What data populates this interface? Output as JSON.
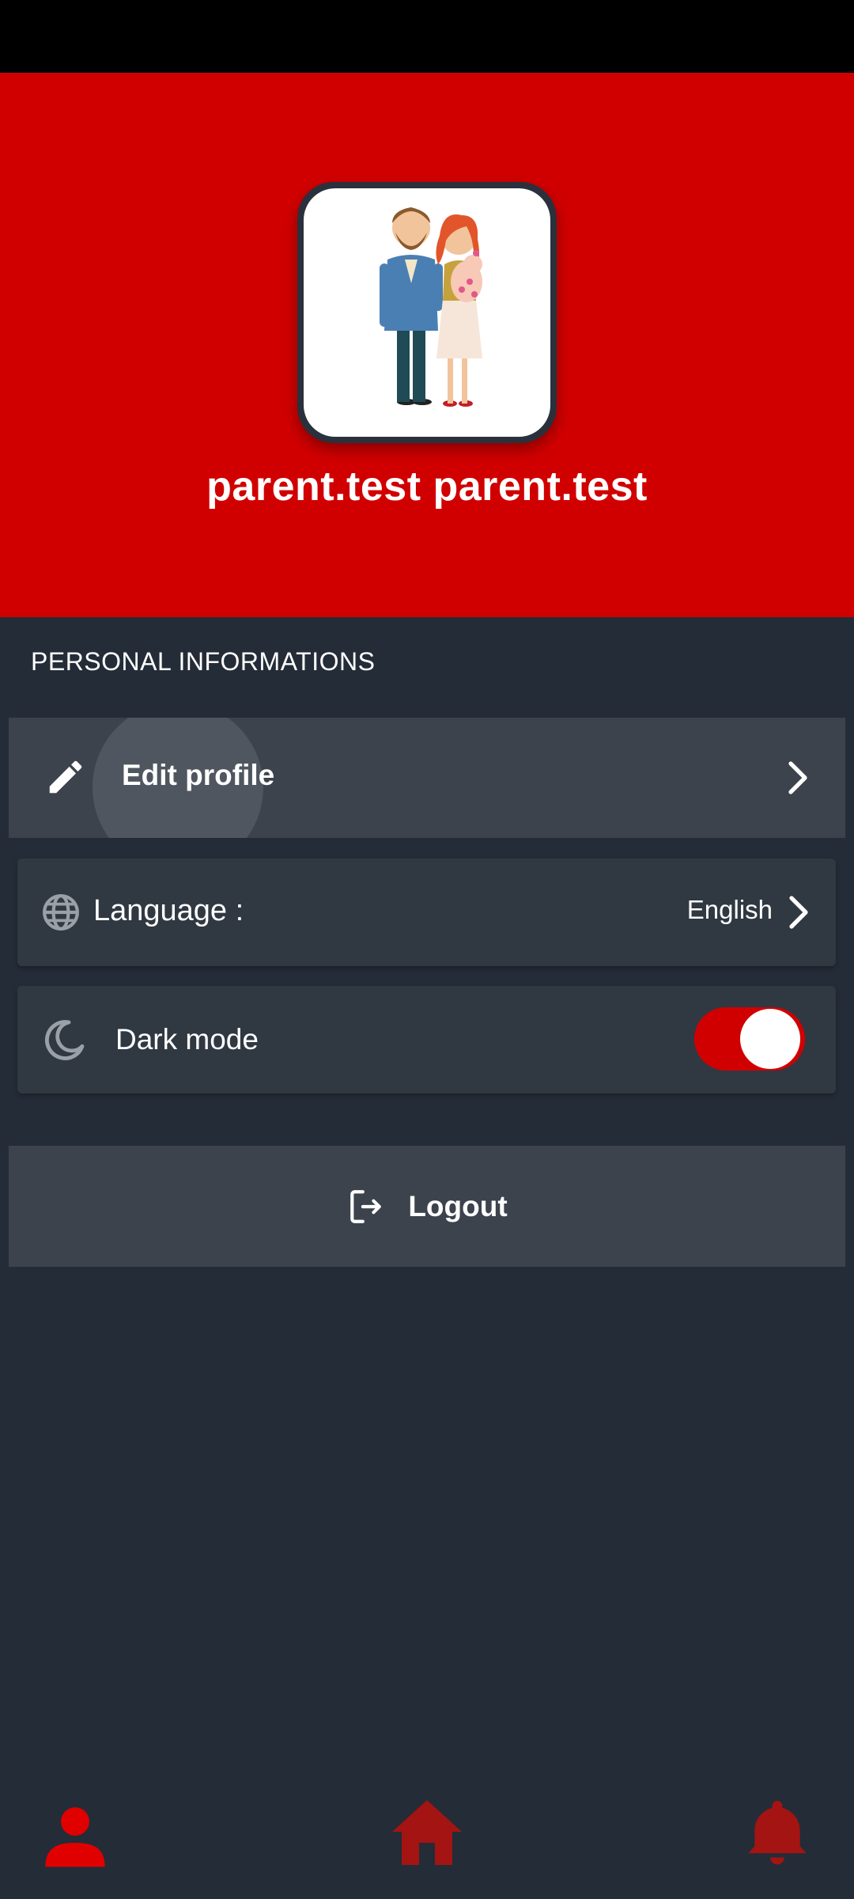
{
  "header": {
    "username": "parent.test parent.test"
  },
  "section": {
    "title": "PERSONAL INFORMATIONS"
  },
  "rows": {
    "edit_profile": {
      "label": "Edit profile",
      "icon": "pencil-icon"
    },
    "language": {
      "label": "Language :",
      "value": "English",
      "icon": "globe-icon"
    },
    "dark_mode": {
      "label": "Dark mode",
      "icon": "moon-icon",
      "enabled": true
    }
  },
  "logout": {
    "label": "Logout",
    "icon": "logout-icon"
  },
  "bottom_nav": {
    "items": [
      {
        "icon": "person-icon",
        "active": true
      },
      {
        "icon": "home-icon",
        "active": false
      },
      {
        "icon": "bell-icon",
        "active": false
      }
    ]
  },
  "colors": {
    "accent": "#d10000",
    "background": "#242c37",
    "card": "#303842",
    "row": "#3c434d",
    "nav_inactive": "#a31412"
  }
}
